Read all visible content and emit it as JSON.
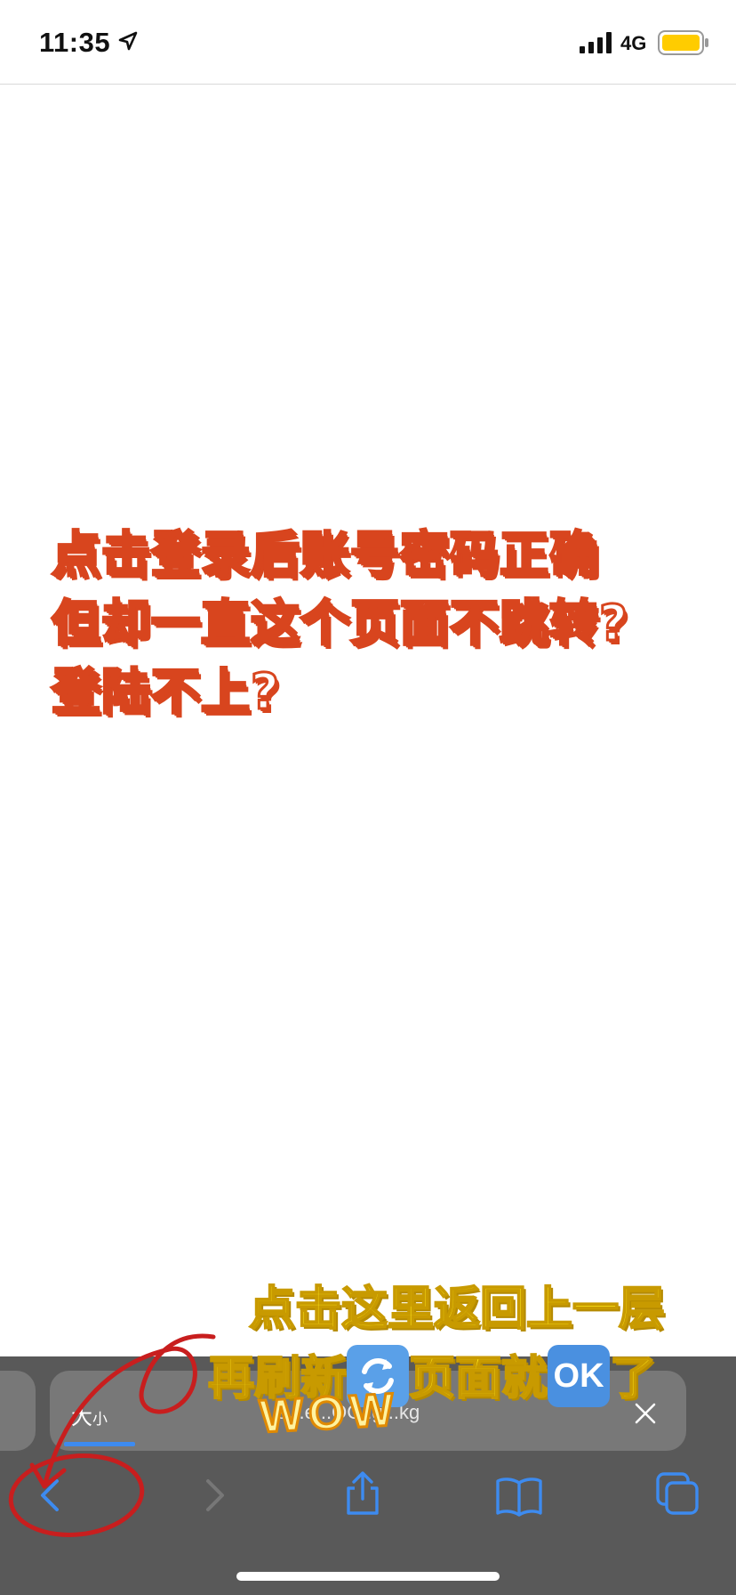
{
  "status_bar": {
    "time": "11:35",
    "network": "4G",
    "battery_color": "#ffcc00"
  },
  "overlay_note": {
    "lines": [
      "点击登录后账号密码正确",
      "但却一直这个页面不跳转?",
      "登陆不上?"
    ],
    "stroke_color": "#d8451e"
  },
  "browser_bar": {
    "text_size_big": "大",
    "text_size_small": "小",
    "url": "a...e...OC..g...kg",
    "accent_color": "#3d8bf0"
  },
  "bottom_toolbar": {
    "icons": [
      "back-icon",
      "forward-icon",
      "share-icon",
      "bookmarks-icon",
      "tabs-icon"
    ]
  },
  "tip_note": {
    "line1": "点击这里返回上一层",
    "line2_part1": "再刷新",
    "line2_part2": "页面就",
    "line2_part3": "了",
    "ok_label": "OK",
    "sticker": "WOW",
    "color": "#ffe81a"
  }
}
